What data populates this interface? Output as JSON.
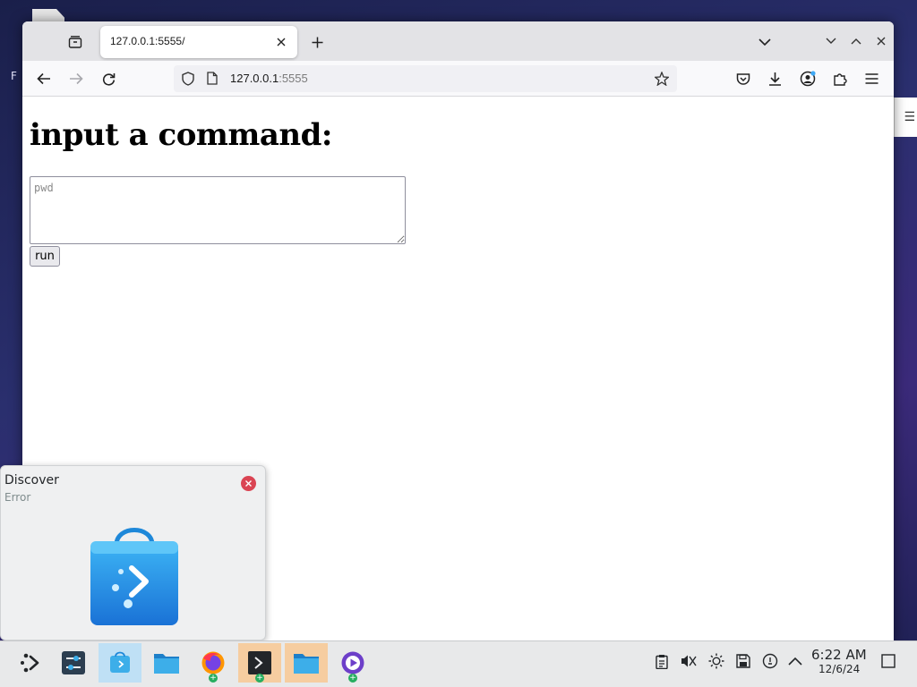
{
  "desktop": {
    "left_peek_text": "F",
    "right_peek_icon": "menu-icon"
  },
  "browser": {
    "tab": {
      "title": "127.0.0.1:5555/",
      "close_icon": "close-icon"
    },
    "url": {
      "host": "127.0.0.1",
      "port": ":5555"
    },
    "toolbar_icons": [
      "back-icon",
      "forward-icon",
      "reload-icon",
      "shield-icon",
      "page-icon",
      "bookmark-star-icon",
      "pocket-icon",
      "download-icon",
      "account-icon",
      "extensions-icon",
      "menu-icon"
    ]
  },
  "page": {
    "heading": "input a command:",
    "textarea_placeholder": "pwd",
    "textarea_value": "",
    "run_label": "run"
  },
  "notification": {
    "title": "Discover",
    "subtitle": "Error",
    "close_color": "#da4453"
  },
  "taskbar": {
    "apps": [
      "application-launcher",
      "system-settings",
      "discover",
      "dolphin-file-manager",
      "firefox",
      "konsole",
      "dolphin-file-manager",
      "media-player"
    ],
    "tray_icons": [
      "clipboard-icon",
      "volume-muted-icon",
      "brightness-icon",
      "disk-icon",
      "updates-icon",
      "expand-tray-icon"
    ],
    "clock": {
      "time": "6:22 AM",
      "date": "12/6/24"
    },
    "show_desktop_icon": "show-desktop-icon"
  },
  "colors": {
    "accent": "#3daee9",
    "active_task": "#bfe0f5",
    "attention_task": "#f6cda0",
    "badge": "#27ae60"
  }
}
